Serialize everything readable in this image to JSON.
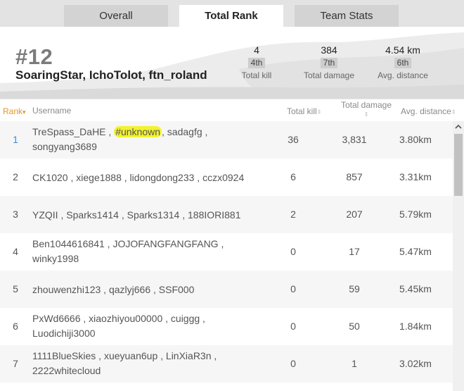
{
  "tabs": [
    {
      "label": "Overall",
      "active": false
    },
    {
      "label": "Total Rank",
      "active": true
    },
    {
      "label": "Team Stats",
      "active": false
    }
  ],
  "header": {
    "rank": "#12",
    "team_names": "SoaringStar, IchoTolot, ftn_roland",
    "stats": [
      {
        "value": "4",
        "rank": "4th",
        "label": "Total kill"
      },
      {
        "value": "384",
        "rank": "7th",
        "label": "Total damage"
      },
      {
        "value": "4.54 km",
        "rank": "6th",
        "label": "Avg. distance"
      }
    ]
  },
  "columns": {
    "rank": "Rank",
    "username": "Username",
    "total_kill": "Total kill",
    "total_damage": "Total damage",
    "avg_distance": "Avg. distance"
  },
  "rows": [
    {
      "rank": "1",
      "line1_pre": "TreSpass_DaHE ,",
      "highlight": "#unknown",
      "line1_post": ", sadagfg ,",
      "line2": "songyang3689",
      "kill": "36",
      "damage": "3,831",
      "distance": "3.80km"
    },
    {
      "rank": "2",
      "line1_pre": "CK1020 , xiege1888 , lidongdong233 , cczx0924",
      "highlight": "",
      "line1_post": "",
      "line2": "",
      "kill": "6",
      "damage": "857",
      "distance": "3.31km"
    },
    {
      "rank": "3",
      "line1_pre": "YZQII , Sparks1414 , Sparks1314 , 188IORI881",
      "highlight": "",
      "line1_post": "",
      "line2": "",
      "kill": "2",
      "damage": "207",
      "distance": "5.79km"
    },
    {
      "rank": "4",
      "line1_pre": "Ben1044616841 , JOJOFANGFANGFANG ,",
      "highlight": "",
      "line1_post": "",
      "line2": "winky1998",
      "kill": "0",
      "damage": "17",
      "distance": "5.47km"
    },
    {
      "rank": "5",
      "line1_pre": "zhouwenzhi123 , qazlyj666 , SSF000",
      "highlight": "",
      "line1_post": "",
      "line2": "",
      "kill": "0",
      "damage": "59",
      "distance": "5.45km"
    },
    {
      "rank": "6",
      "line1_pre": "PxWd6666 , xiaozhiyou00000 , cuiggg ,",
      "highlight": "",
      "line1_post": "",
      "line2": "Luodichiji3000",
      "kill": "0",
      "damage": "50",
      "distance": "1.84km"
    },
    {
      "rank": "7",
      "line1_pre": "1111BlueSkies , xueyuan6up , LinXiaR3n ,",
      "highlight": "",
      "line1_post": "",
      "line2": "2222whitecloud",
      "kill": "0",
      "damage": "1",
      "distance": "3.02km"
    }
  ],
  "colors": {
    "accent_sort": "#e0962a",
    "rank_link": "#3a8fd6",
    "highlight": "#f2f230"
  }
}
